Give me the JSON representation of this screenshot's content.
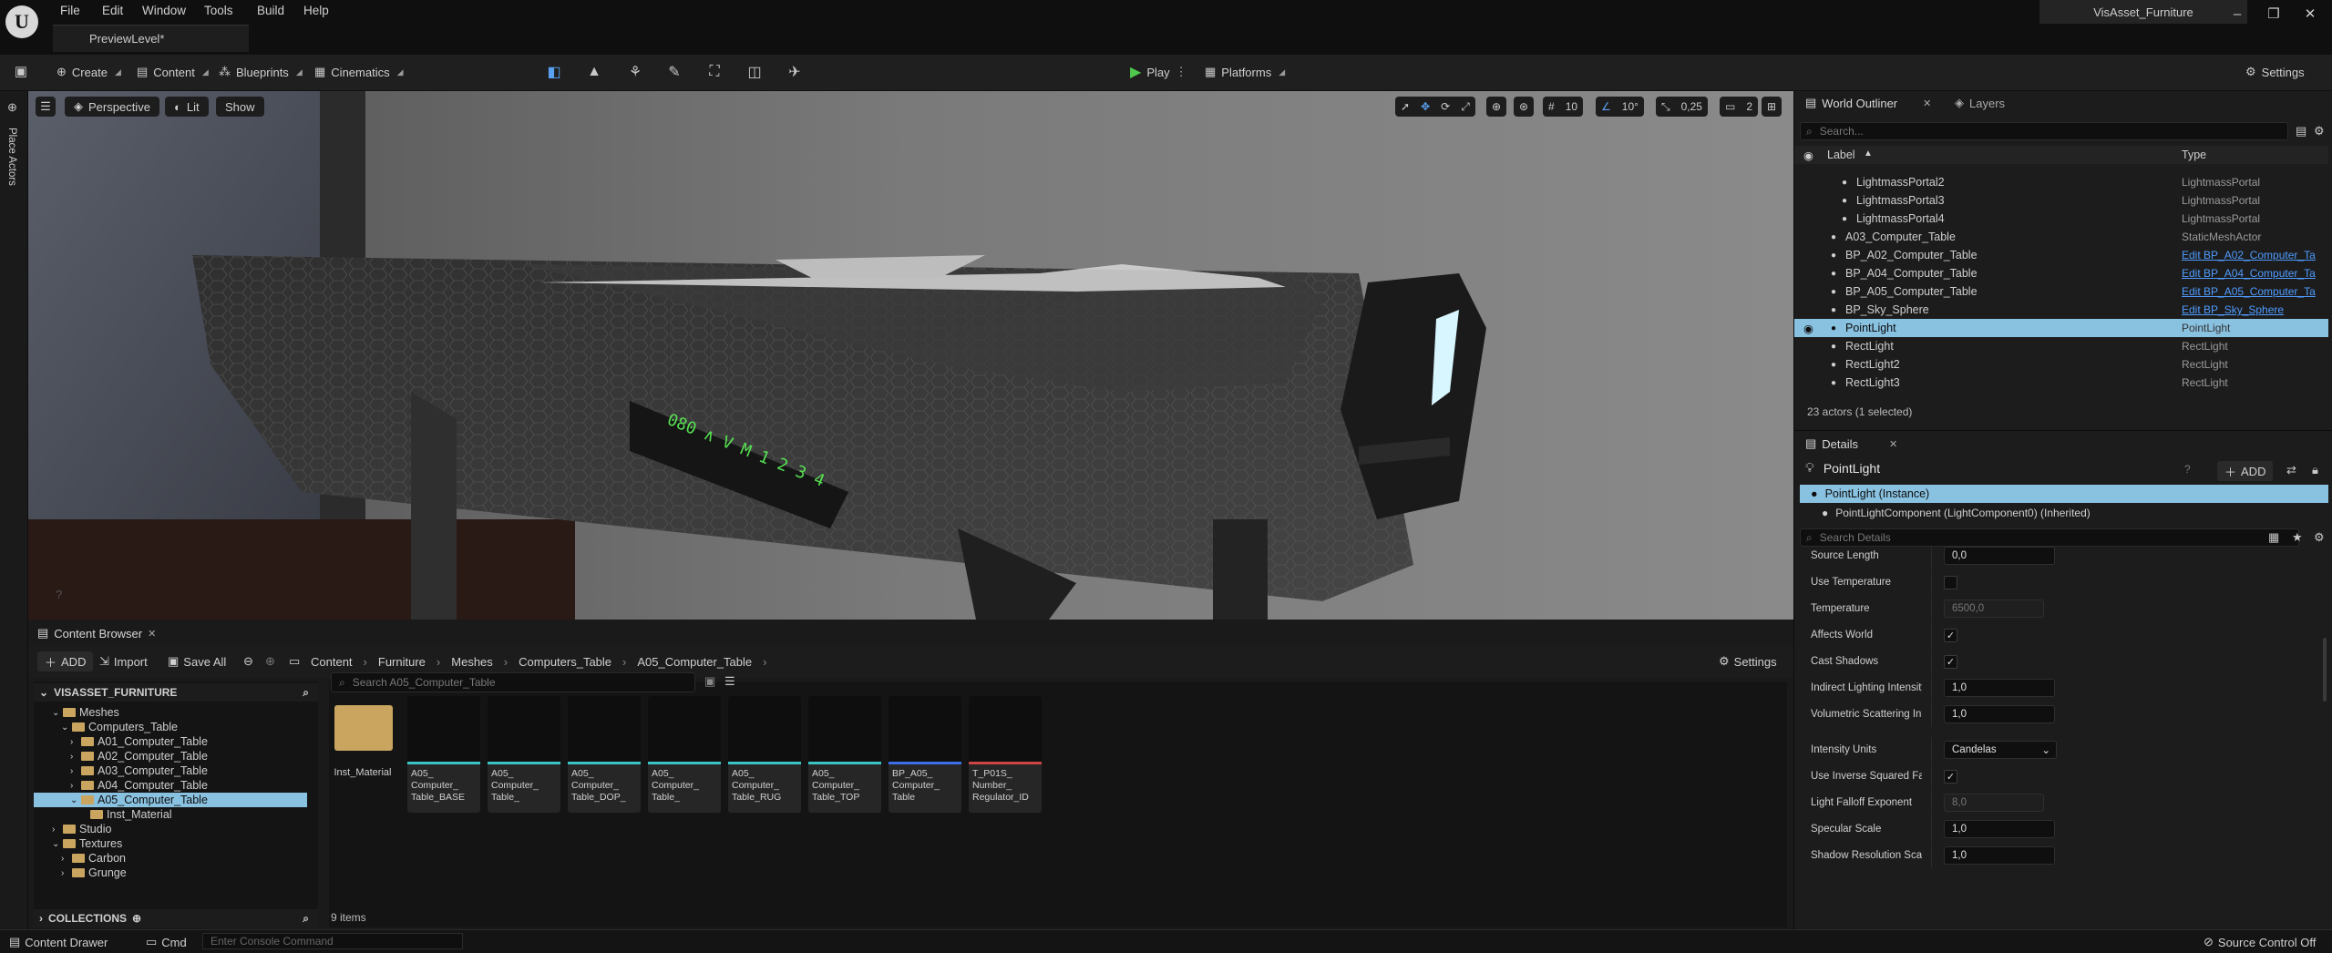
{
  "app": {
    "project_name": "VisAsset_Furniture",
    "level_tab": "PreviewLevel*"
  },
  "menu": [
    "File",
    "Edit",
    "Window",
    "Tools",
    "Build",
    "Help"
  ],
  "toolbar": {
    "create": "Create",
    "content": "Content",
    "blueprints": "Blueprints",
    "cinematics": "Cinematics",
    "play": "Play",
    "platforms": "Platforms",
    "settings": "Settings"
  },
  "sidebar": {
    "place_actors": "Place Actors"
  },
  "viewport": {
    "perspective": "Perspective",
    "lit": "Lit",
    "show": "Show",
    "grid_snap": "10",
    "rot_snap": "10°",
    "scale_snap": "0,25",
    "camera_speed": "2",
    "desk_display": "080 ∧ V M 1 2 3 4"
  },
  "content_browser": {
    "tab": "Content Browser",
    "add": "ADD",
    "import": "Import",
    "save_all": "Save All",
    "breadcrumbs": [
      "Content",
      "Furniture",
      "Meshes",
      "Computers_Table",
      "A05_Computer_Table"
    ],
    "settings": "Settings",
    "root": "VISASSET_FURNITURE",
    "tree": [
      {
        "label": "Meshes",
        "level": 2,
        "expanded": true
      },
      {
        "label": "Computers_Table",
        "level": 3,
        "expanded": true
      },
      {
        "label": "A01_Computer_Table",
        "level": 4
      },
      {
        "label": "A02_Computer_Table",
        "level": 4
      },
      {
        "label": "A03_Computer_Table",
        "level": 4
      },
      {
        "label": "A04_Computer_Table",
        "level": 4
      },
      {
        "label": "A05_Computer_Table",
        "level": 4,
        "expanded": true,
        "selected": true
      },
      {
        "label": "Inst_Material",
        "level": 5
      },
      {
        "label": "Studio",
        "level": 2
      },
      {
        "label": "Textures",
        "level": 2,
        "expanded": true
      },
      {
        "label": "Carbon",
        "level": 3
      },
      {
        "label": "Grunge",
        "level": 3
      }
    ],
    "collections": "COLLECTIONS",
    "search_placeholder": "Search A05_Computer_Table",
    "folder": "Inst_Material",
    "assets": [
      "A05_\nComputer_\nTable_BASE",
      "A05_\nComputer_\nTable_",
      "A05_\nComputer_\nTable_DOP_",
      "A05_\nComputer_\nTable_",
      "A05_\nComputer_\nTable_RUG",
      "A05_\nComputer_\nTable_TOP",
      "BP_A05_\nComputer_\nTable",
      "T_P01S_\nNumber_\nRegulator_ID"
    ],
    "item_count": "9 items"
  },
  "outliner": {
    "tab": "World Outliner",
    "tab2": "Layers",
    "search_placeholder": "Search...",
    "col_label": "Label",
    "col_type": "Type",
    "rows": [
      {
        "label": "LightmassPortal2",
        "type": "LightmassPortal",
        "indent": 2
      },
      {
        "label": "LightmassPortal3",
        "type": "LightmassPortal",
        "indent": 2
      },
      {
        "label": "LightmassPortal4",
        "type": "LightmassPortal",
        "indent": 2
      },
      {
        "label": "A03_Computer_Table",
        "type": "StaticMeshActor",
        "indent": 1
      },
      {
        "label": "BP_A02_Computer_Table",
        "type": "Edit BP_A02_Computer_Ta",
        "indent": 1,
        "link": true
      },
      {
        "label": "BP_A04_Computer_Table",
        "type": "Edit BP_A04_Computer_Ta",
        "indent": 1,
        "link": true
      },
      {
        "label": "BP_A05_Computer_Table",
        "type": "Edit BP_A05_Computer_Ta",
        "indent": 1,
        "link": true
      },
      {
        "label": "BP_Sky_Sphere",
        "type": "Edit BP_Sky_Sphere",
        "indent": 1,
        "link": true
      },
      {
        "label": "PointLight",
        "type": "PointLight",
        "indent": 1,
        "selected": true
      },
      {
        "label": "RectLight",
        "type": "RectLight",
        "indent": 1
      },
      {
        "label": "RectLight2",
        "type": "RectLight",
        "indent": 1
      },
      {
        "label": "RectLight3",
        "type": "RectLight",
        "indent": 1
      }
    ],
    "status": "23 actors (1 selected)"
  },
  "details": {
    "tab": "Details",
    "title": "PointLight",
    "add": "ADD",
    "instance": "PointLight (Instance)",
    "component": "PointLightComponent (LightComponent0) (Inherited)",
    "search_placeholder": "Search Details",
    "props": [
      {
        "name": "Source Length",
        "kind": "value",
        "value": "0,0"
      },
      {
        "name": "Use Temperature",
        "kind": "check",
        "value": ""
      },
      {
        "name": "Temperature",
        "kind": "dim",
        "value": "6500,0"
      },
      {
        "name": "Affects World",
        "kind": "check",
        "value": "✓"
      },
      {
        "name": "Cast Shadows",
        "kind": "check",
        "value": "✓"
      },
      {
        "name": "Indirect Lighting Intensity",
        "kind": "value",
        "value": "1,0"
      },
      {
        "name": "Volumetric Scattering Intensity",
        "kind": "value",
        "value": "1,0"
      },
      {
        "name": "Intensity Units",
        "kind": "dropdown",
        "value": "Candelas"
      },
      {
        "name": "Use Inverse Squared Falloff",
        "kind": "check",
        "value": "✓"
      },
      {
        "name": "Light Falloff Exponent",
        "kind": "dim",
        "value": "8,0"
      },
      {
        "name": "Specular Scale",
        "kind": "value",
        "value": "1,0"
      },
      {
        "name": "Shadow Resolution Scale",
        "kind": "value",
        "value": "1,0"
      }
    ]
  },
  "status": {
    "content_drawer": "Content Drawer",
    "cmd": "Cmd",
    "console_placeholder": "Enter Console Command",
    "source_control": "Source Control Off"
  },
  "colors": {
    "accent": "#3d8ee8",
    "selection": "#89c1e0",
    "play": "#4ec94e",
    "folder": "#c9a560"
  }
}
